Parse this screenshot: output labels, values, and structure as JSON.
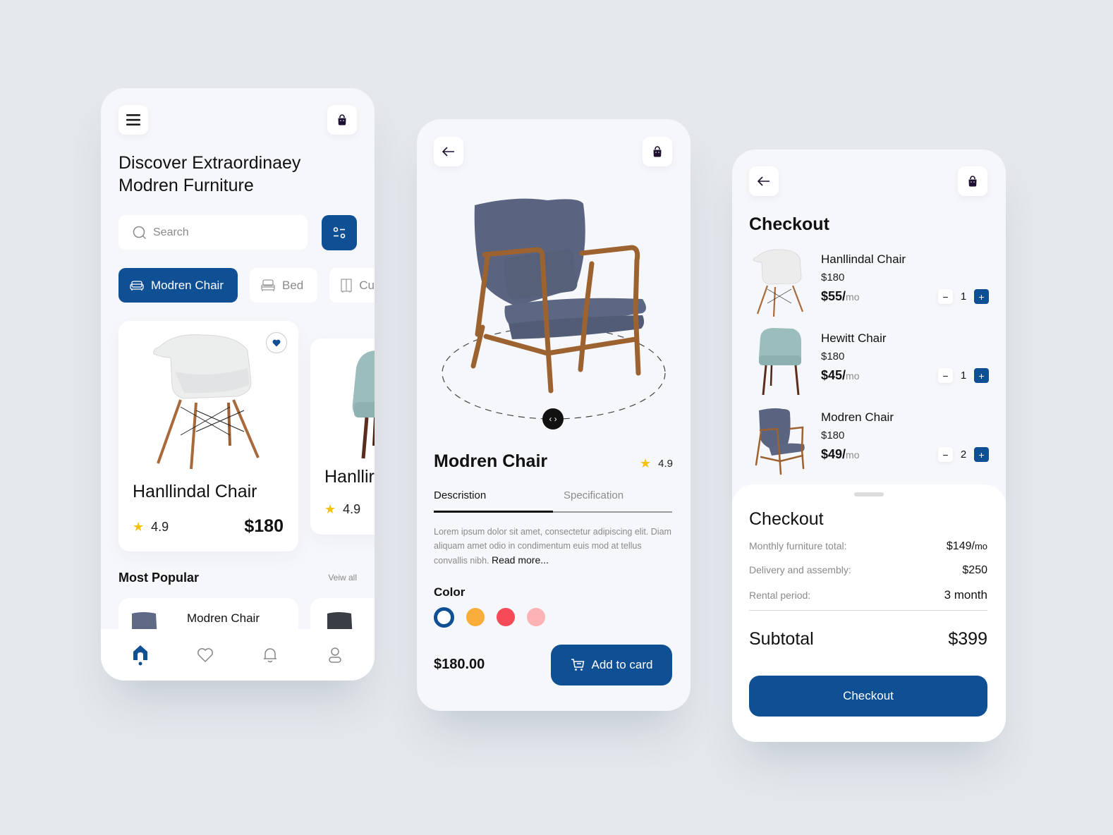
{
  "colors": {
    "accent": "#0f4f93",
    "star": "#f4c20d",
    "background": "#e4e8ec",
    "screen": "#f6f7fb"
  },
  "home": {
    "menu_icon": "hamburger-menu-icon",
    "cart_icon": "shopping-bag-icon",
    "title_line1": "Discover Extraordinaey",
    "title_line2": "Modren Furniture",
    "search": {
      "placeholder": "Search",
      "value": ""
    },
    "filter_icon": "sliders-filter-icon",
    "categories": [
      {
        "label": "Modren Chair",
        "icon": "sofa-icon",
        "active": true
      },
      {
        "label": "Bed",
        "icon": "bed-icon",
        "active": false
      },
      {
        "label": "Cu",
        "icon": "cupboard-icon",
        "active": false
      }
    ],
    "products": [
      {
        "name": "Hanllindal Chair",
        "rating": "4.9",
        "price": "$180",
        "favorite": true
      },
      {
        "name": "Hanllir",
        "rating": "4.9"
      }
    ],
    "most_popular": {
      "title": "Most Popular",
      "view_all": "Veiw all",
      "items": [
        {
          "name": "Modren Chair"
        }
      ]
    },
    "nav": [
      {
        "name": "home",
        "icon": "home-icon",
        "active": true
      },
      {
        "name": "favorites",
        "icon": "heart-icon",
        "active": false
      },
      {
        "name": "notifications",
        "icon": "bell-icon",
        "active": false
      },
      {
        "name": "profile",
        "icon": "user-icon",
        "active": false
      }
    ]
  },
  "detail": {
    "back_icon": "arrow-left-icon",
    "cart_icon": "shopping-bag-icon",
    "name": "Modren Chair",
    "rating": "4.9",
    "tabs": [
      {
        "label": "Descristion",
        "active": true
      },
      {
        "label": "Specification",
        "active": false
      }
    ],
    "description": "Lorem ipsum dolor sit amet, consectetur adipiscing elit. Diam aliquam amet odio in condimentum euis mod at tellus convallis nibh.",
    "read_more": "Read more...",
    "color_label": "Color",
    "colors": [
      {
        "hex": "#ffffff",
        "selected": true
      },
      {
        "hex": "#f9ae3b",
        "selected": false
      },
      {
        "hex": "#f64a58",
        "selected": false
      },
      {
        "hex": "#fdb3b5",
        "selected": false
      }
    ],
    "price": "$180.00",
    "add_button": "Add to card"
  },
  "checkout": {
    "back_icon": "arrow-left-icon",
    "cart_icon": "shopping-bag-icon",
    "title": "Checkout",
    "items": [
      {
        "name": "Hanllindal Chair",
        "price": "$180",
        "monthly": "$55/",
        "unit": "mo",
        "qty": "1"
      },
      {
        "name": "Hewitt Chair",
        "price": "$180",
        "monthly": "$45/",
        "unit": "mo",
        "qty": "1"
      },
      {
        "name": "Modren Chair",
        "price": "$180",
        "monthly": "$49/",
        "unit": "mo",
        "qty": "2"
      }
    ],
    "summary": {
      "title": "Checkout",
      "rows": [
        {
          "label": "Monthly furniture total:",
          "value": "$149/",
          "unit": "mo"
        },
        {
          "label": "Delivery and assembly:",
          "value": "$250",
          "unit": ""
        },
        {
          "label": "Rental period:",
          "value": "3 month",
          "unit": ""
        }
      ],
      "subtotal_label": "Subtotal",
      "subtotal_value": "$399",
      "button": "Checkout"
    }
  }
}
